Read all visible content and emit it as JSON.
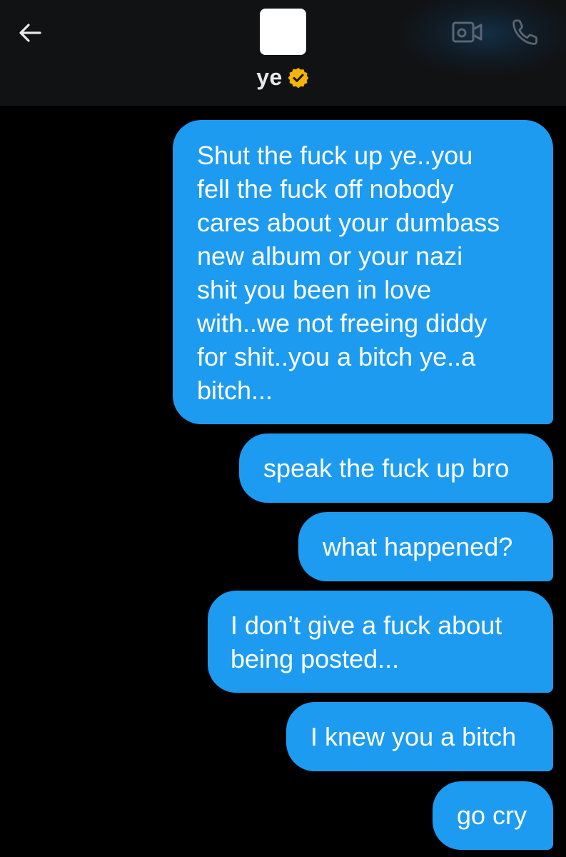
{
  "header": {
    "contact_name": "ye",
    "verified_badge_color": "#f4b400",
    "icons": {
      "back": "arrow-left-icon",
      "video": "video-camera-icon",
      "call": "phone-icon",
      "verified": "verified-badge-icon"
    }
  },
  "colors": {
    "background": "#000000",
    "header_background": "#111214",
    "sent_bubble": "#1d9bf0",
    "bubble_text": "#ffffff",
    "header_text": "#e7e9ea",
    "icon_muted": "#5b6570"
  },
  "messages": [
    {
      "sender": "me",
      "text": "Shut the fuck up ye..you\nfell the fuck off nobody\ncares about your dumbass\nnew album or your nazi\nshit you been in love\nwith..we not freeing diddy\nfor shit..you a bitch ye..a\nbitch..."
    },
    {
      "sender": "me",
      "text": "speak the fuck up bro"
    },
    {
      "sender": "me",
      "text": "what happened?"
    },
    {
      "sender": "me",
      "text": "I don’t give a fuck about\nbeing posted..."
    },
    {
      "sender": "me",
      "text": "I knew you a bitch"
    },
    {
      "sender": "me",
      "text": "go cry"
    }
  ]
}
